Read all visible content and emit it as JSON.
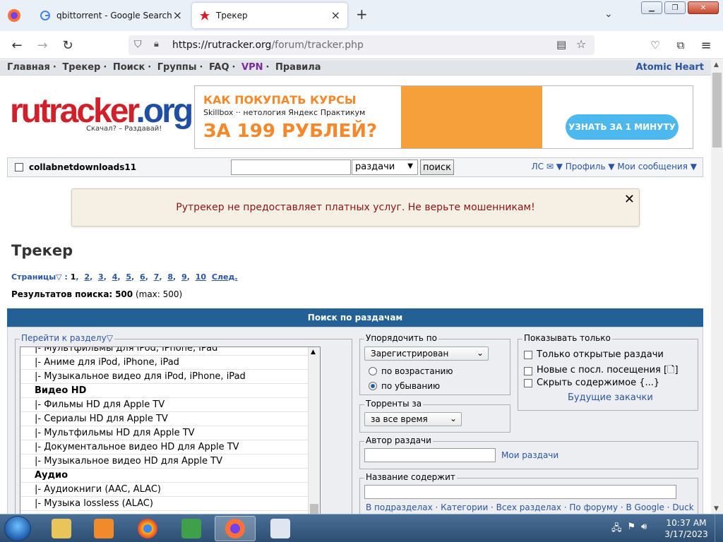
{
  "browser": {
    "tabs": [
      {
        "label": "qbittorrent - Google Search",
        "favicon": "google-g-icon"
      },
      {
        "label": "Трекер",
        "favicon": "rutracker-star-icon",
        "active": true
      }
    ],
    "url_host": "https://rutracker.org",
    "url_path": "/forum/tracker.php"
  },
  "site": {
    "topnav": [
      "Главная",
      "Трекер",
      "Поиск",
      "Группы",
      "FAQ",
      "VPN",
      "Правила"
    ],
    "topnav_right": "Atomic Heart",
    "logo_text_1": "rutracker",
    "logo_text_2": ".org",
    "logo_sub": "Скачал? – Раздавай!",
    "banner": {
      "title": "КАК ПОКУПАТЬ КУРСЫ",
      "brands": "Skillbox   ·· нетология   Яндекс Практикум",
      "price": "ЗА 199 РУБЛЕЙ?",
      "cta": "УЗНАТЬ ЗА 1 МИНУТУ"
    },
    "userbar": {
      "username": "collabnetdownloads11",
      "search_scope": "раздачи",
      "search_button": "поиск",
      "links": "ЛС ✉ ▼   Профиль ▼   Мои сообщения ▼"
    },
    "notice": "Рутрекер не предоставляет платных услуг. Не верьте мошенникам!",
    "page_title": "Трекер",
    "pages_label": "Страницы",
    "pages": [
      "1",
      "2",
      "3",
      "4",
      "5",
      "6",
      "7",
      "8",
      "9",
      "10"
    ],
    "pages_next": "След.",
    "results_label": "Результатов поиска:",
    "results_count": "500",
    "results_max": "(max: 500)"
  },
  "search_panel": {
    "header": "Поиск по раздачам",
    "forum_legend": "Перейти к разделу",
    "forum_items": [
      {
        "label": "|- Мультфильмы для iPod, iPhone, iPad",
        "group": false
      },
      {
        "label": "|- Аниме для iPod, iPhone, iPad",
        "group": false
      },
      {
        "label": "|- Музыкальное видео для iPod, iPhone, iPad",
        "group": false
      },
      {
        "label": "Видео HD",
        "group": true
      },
      {
        "label": "|- Фильмы HD для Apple TV",
        "group": false
      },
      {
        "label": "|- Сериалы HD для Apple TV",
        "group": false
      },
      {
        "label": "|- Мультфильмы HD для Apple TV",
        "group": false
      },
      {
        "label": "|- Документальное видео HD для Apple TV",
        "group": false
      },
      {
        "label": "|- Музыкальное видео HD для Apple TV",
        "group": false
      },
      {
        "label": "Аудио",
        "group": true
      },
      {
        "label": "|- Аудиокниги (AAC, ALAC)",
        "group": false
      },
      {
        "label": "|- Музыка lossless (ALAC)",
        "group": false
      }
    ],
    "sort_legend": "Упорядочить по",
    "sort_value": "Зарегистрирован",
    "sort_asc": "по возрастанию",
    "sort_desc": "по убыванию",
    "period_legend": "Торренты за",
    "period_value": "за все время",
    "show_legend": "Показывать только",
    "show_open": "Только открытые раздачи",
    "show_new": "Новые с посл. посещения [🗋]",
    "show_hide": "Скрыть содержимое {...}",
    "future": "Будущие закачки",
    "author_legend": "Автор раздачи",
    "my_releases": "Мои раздачи",
    "title_legend": "Название содержит",
    "title_links": "В подразделах  ·  Категории  ·  Всех разделах  ·  По форуму  ·  В Google  ·  Duck"
  },
  "taskbar": {
    "time": "10:37 AM",
    "date": "3/17/2023"
  }
}
